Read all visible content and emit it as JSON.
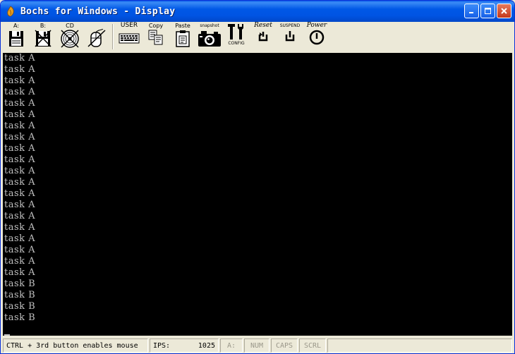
{
  "window": {
    "title": "Bochs for Windows - Display"
  },
  "toolbar": {
    "floppy_a_label": "A:",
    "floppy_b_label": "B:",
    "cdrom_label": "CD",
    "user_label": "USER",
    "copy_label": "Copy",
    "paste_label": "Paste",
    "snapshot_label": "snapshot",
    "config_label": "CONFIG",
    "reset_label": "Reset",
    "suspend_label": "SUSPEND",
    "power_label": "Power"
  },
  "display": {
    "lines": [
      "task A",
      "task A",
      "task A",
      "task A",
      "task A",
      "task A",
      "task A",
      "task A",
      "task A",
      "task A",
      "task A",
      "task A",
      "task A",
      "task A",
      "task A",
      "task A",
      "task A",
      "task A",
      "task A",
      "task A",
      "task B",
      "task B",
      "task B",
      "task B"
    ]
  },
  "statusbar": {
    "hint": "CTRL + 3rd button enables mouse",
    "ips_label": "IPS:",
    "ips_value": "1025",
    "drive": "A:",
    "num": "NUM",
    "caps": "CAPS",
    "scrl": "SCRL"
  },
  "colors": {
    "titlebar": "#0054e3",
    "console_bg": "#000000",
    "console_fg": "#c0c0c0",
    "chrome": "#ece9d8"
  }
}
